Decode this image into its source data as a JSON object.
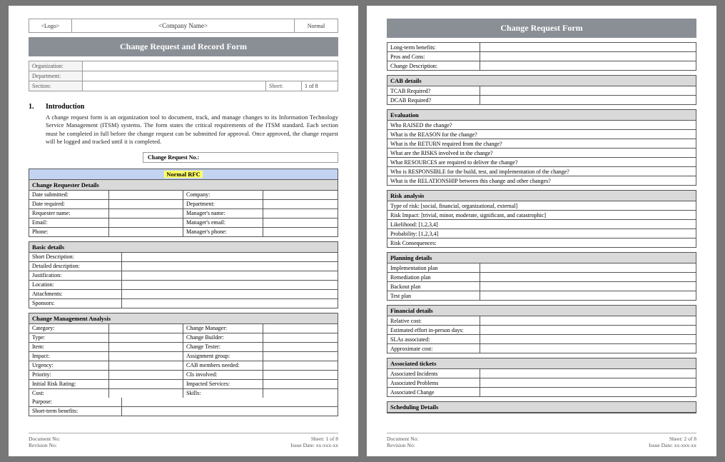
{
  "header": {
    "logo": "<Logo>",
    "company": "<Company Name>",
    "normal": "Normal"
  },
  "banner1": "Change Request and Record Form",
  "banner2": "Change Request Form",
  "org_labels": {
    "org": "Organization:",
    "dept": "Department:",
    "sect": "Section:",
    "sheet": "Sheet:",
    "sheet_v": "1 of 8"
  },
  "sec1": {
    "num": "1.",
    "title": "Introduction"
  },
  "intro": "A change request form is an organization tool to document, track, and manage changes to its Information Technology Service Management (ITSM) systems. The form states the critical requirements of the ITSM standard. Each section must be completed in full before the change request can be submitted for approval. Once approved, the change request will be logged and tracked until it is completed.",
  "crn": "Change Request No.:",
  "rfc_hdr": "Normal RFC",
  "requester": {
    "hdr": "Change Requester Details",
    "rows": [
      [
        "Date submitted:",
        "Company:"
      ],
      [
        "Date required:",
        "Department:"
      ],
      [
        "Requester name:",
        "Manager's name:"
      ],
      [
        "Email:",
        "Manager's email:"
      ],
      [
        "Phone:",
        "Manager's phone:"
      ]
    ]
  },
  "basic": {
    "hdr": "Basic details",
    "rows": [
      "Short Description:",
      "Detailed description:",
      "Justification:",
      "Location:",
      "Attachments:",
      "Sponsors:"
    ]
  },
  "cma": {
    "hdr": "Change Management Analysis",
    "rows": [
      [
        "Category:",
        "Change Manager:"
      ],
      [
        "Type:",
        "Change Builder:"
      ],
      [
        "Item:",
        "Change Tester:"
      ],
      [
        "Impact:",
        "Assignment group:"
      ],
      [
        "Urgency:",
        "CAB members needed:"
      ],
      [
        "Priority:",
        "CIs involved:"
      ],
      [
        "Initial Risk Rating:",
        "Impacted Services:"
      ],
      [
        "Cost:",
        "Skills:"
      ]
    ],
    "tail": [
      "Purpose:",
      "Short-term benefits:"
    ]
  },
  "p2top": {
    "rows": [
      "Long-term benefits:",
      "Pros and Cons:",
      "Change Description:"
    ]
  },
  "cab": {
    "hdr": "CAB details",
    "rows": [
      "TCAB Required?",
      "DCAB Required?"
    ]
  },
  "eval": {
    "hdr": "Evaluation",
    "rows": [
      "Who RAISED the change?",
      "What is the REASON for the change?",
      "What is the RETURN required from the change?",
      "What are the RISKS involved in the change?",
      "What RESOURCES are required to deliver the change?",
      "Who is RESPONSIBLE for the build, test, and implementation of the change?",
      "What is the RELATIONSHIP between this change and other changes?"
    ]
  },
  "risk": {
    "hdr": "Risk analysis",
    "rows": [
      "Type of risk: [social, financial, organizational, external]",
      "Risk Impact: [trivial, minor, moderate, significant, and catastrophic]",
      "Likelihood: [1,2,3,4]",
      "Probability: [1,2,3,4]",
      "Risk Consequences:"
    ]
  },
  "plan": {
    "hdr": "Planning details",
    "rows": [
      "Implementation plan",
      "Remediation plan",
      "Backout plan",
      "Test plan"
    ]
  },
  "fin": {
    "hdr": "Financial details",
    "rows": [
      "Relative cost:",
      "Estimated effort in-person days:",
      "SLAs associated:",
      "Approximate cost:"
    ]
  },
  "assoc": {
    "hdr": "Associated tickets",
    "rows": [
      "Associated Incidents",
      "Associated Problems",
      "Associated Change"
    ]
  },
  "sched": {
    "hdr": "Scheduling Details"
  },
  "footer": {
    "doc": "Document No:",
    "rev": "Revision No:",
    "sheet1": "Sheet: 1 of 8",
    "sheet2": "Sheet: 2 of 8",
    "issue": "Issue Date: xx-xxx-xx"
  }
}
